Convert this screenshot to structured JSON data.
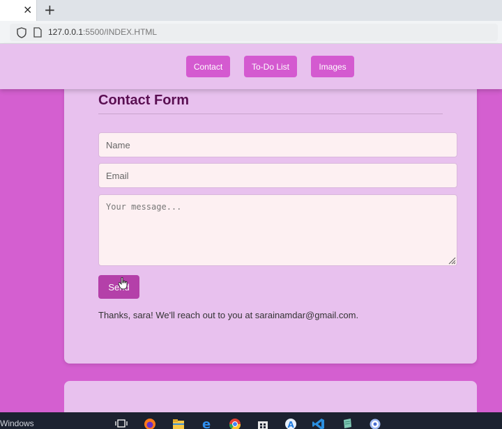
{
  "browser": {
    "tab_close_glyph": "×",
    "new_tab_glyph": "+",
    "url_host": "127.0.0.1",
    "url_rest": ":5500/INDEX.HTML"
  },
  "nav": {
    "contact": "Contact",
    "todo": "To-Do List",
    "images": "Images"
  },
  "form": {
    "title": "Contact Form",
    "name_placeholder": "Name",
    "email_placeholder": "Email",
    "message_placeholder": "Your message...",
    "send_label": "Send",
    "confirmation": "Thanks, sara! We'll reach out to you at sarainamdar@gmail.com."
  },
  "taskbar": {
    "label": "Windows",
    "icons": [
      "task-view-icon",
      "firefox-icon",
      "file-explorer-icon",
      "edge-icon",
      "chrome-icon",
      "store-icon",
      "app-store-icon",
      "vscode-icon",
      "notepad-icon",
      "settings-icon"
    ]
  },
  "colors": {
    "page_bg": "#d45fd0",
    "card_bg": "#e8c1ee",
    "nav_button": "#d45ad0",
    "send_button": "#b440a9",
    "title": "#5a0f52"
  }
}
